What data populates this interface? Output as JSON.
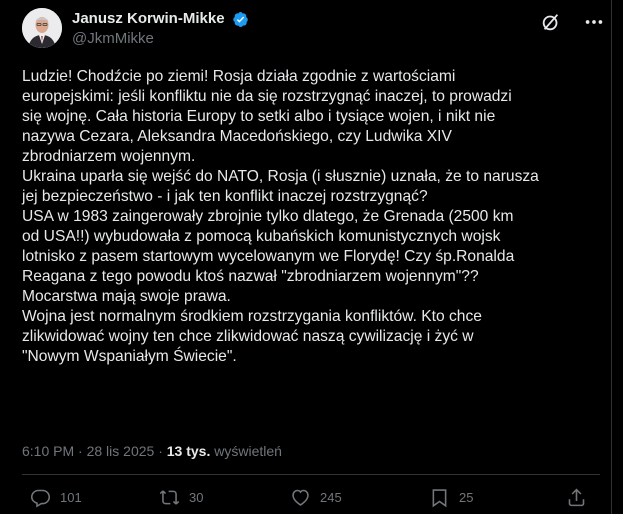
{
  "author": {
    "display_name": "Janusz Korwin-Mikke",
    "handle": "@JkmMikke"
  },
  "tweet": {
    "text": "Ludzie! Chodźcie po ziemi! Rosja działa zgodnie z wartościami\neuropejskimi: jeśli konfliktu nie da się rozstrzygnąć inaczej, to prowadzi\nsię wojnę. Cała historia Europy to setki albo i tysiące wojen, i nikt nie\nnazywa Cezara, Aleksandra Macedońskiego, czy Ludwika XIV\nzbrodniarzem wojennym.\nUkraina uparła się wejść do NATO, Rosja (i słusznie) uznała, że to narusza\njej bezpieczeństwo - i jak ten konflikt inaczej rozstrzygnąć?\nUSA w 1983 zaingerowały zbrojnie tylko dlatego, że Grenada (2500 km\nod USA!!) wybudowała z pomocą kubańskich komunistycznych wojsk\nlotnisko z pasem startowym wycelowanym we Florydę! Czy śp.Ronalda\nReagana z tego powodu ktoś nazwał \"zbrodniarzem wojennym\"??\nMocarstwa mają swoje prawa.\nWojna jest normalnym środkiem rozstrzygania konfliktów. Kto chce\nzlikwidować wojny ten chce zlikwidować naszą cywilizację i żyć w\n\"Nowym Wspaniałym Świecie\".",
    "time": "6:10 PM",
    "dot": " · ",
    "date": "28 lis 2025",
    "views_count": "13 tys.",
    "views_label": " wyświetleń"
  },
  "actions": {
    "replies": "101",
    "reposts": "30",
    "likes": "245",
    "bookmarks": "25"
  },
  "colors": {
    "background": "#000000",
    "text": "#e7e9ea",
    "secondary": "#71767b",
    "verified": "#1d9bf0",
    "border": "#2f3336"
  },
  "icons": {
    "verified": "verified-badge-icon",
    "grok": "grok-icon",
    "more": "more-icon",
    "reply": "reply-icon",
    "repost": "repost-icon",
    "like": "like-icon",
    "bookmark": "bookmark-icon",
    "share": "share-icon"
  }
}
